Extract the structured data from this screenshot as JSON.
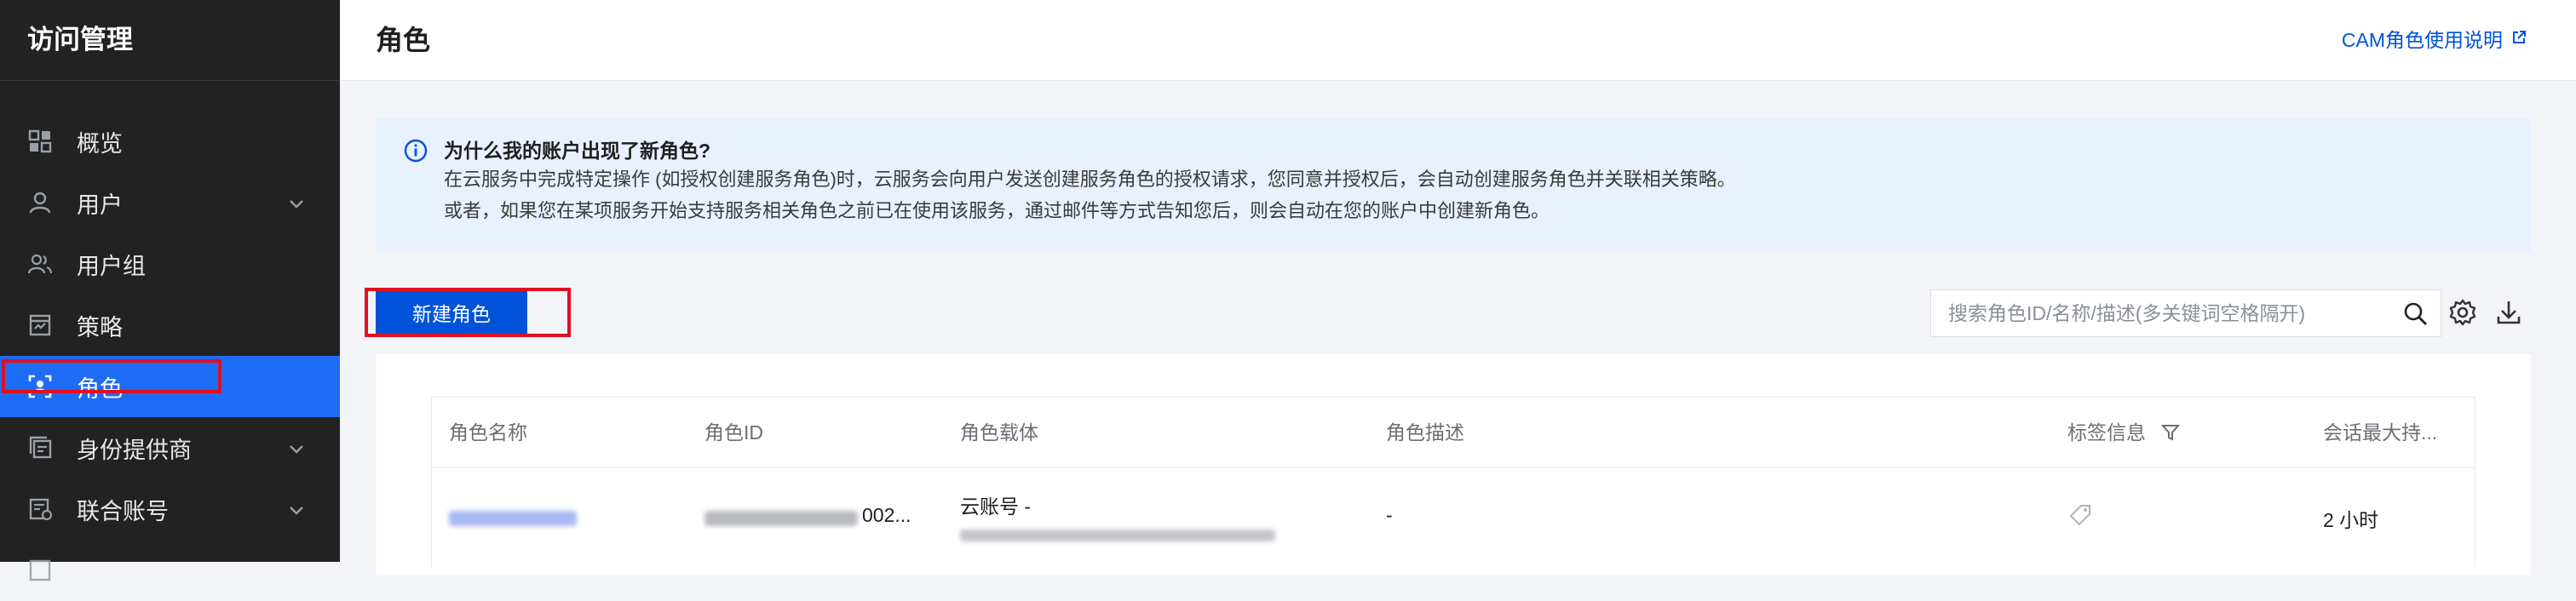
{
  "app": {
    "title": "访问管理"
  },
  "sidebar": {
    "items": [
      {
        "label": "概览",
        "icon": "dashboard-grid-icon",
        "has_chevron": false
      },
      {
        "label": "用户",
        "icon": "user-icon",
        "has_chevron": true
      },
      {
        "label": "用户组",
        "icon": "user-group-icon",
        "has_chevron": false
      },
      {
        "label": "策略",
        "icon": "policy-icon",
        "has_chevron": false
      },
      {
        "label": "角色",
        "icon": "role-icon",
        "has_chevron": false,
        "active": true
      },
      {
        "label": "身份提供商",
        "icon": "identity-provider-icon",
        "has_chevron": true
      },
      {
        "label": "联合账号",
        "icon": "federated-account-icon",
        "has_chevron": true
      }
    ]
  },
  "header": {
    "title": "角色",
    "doc_link": "CAM角色使用说明",
    "doc_link_icon": "external-link-icon"
  },
  "notice": {
    "icon": "info-icon",
    "title": "为什么我的账户出现了新角色?",
    "line1": "在云服务中完成特定操作 (如授权创建服务角色)时，云服务会向用户发送创建服务角色的授权请求，您同意并授权后，会自动创建服务角色并关联相关策略。",
    "line2": "或者，如果您在某项服务开始支持服务相关角色之前已在使用该服务，通过邮件等方式告知您后，则会自动在您的账户中创建新角色。"
  },
  "toolbar": {
    "create_label": "新建角色",
    "search_placeholder": "搜索角色ID/名称/描述(多关键词空格隔开)",
    "search_icon": "search-icon",
    "settings_icon": "gear-icon",
    "download_icon": "download-icon"
  },
  "table": {
    "columns": [
      "角色名称",
      "角色ID",
      "角色载体",
      "角色描述",
      "标签信息",
      "会话最大持..."
    ],
    "filter_icon": "filter-icon",
    "rows": [
      {
        "id_suffix": "002...",
        "carrier_line1": "云账号 -",
        "description": "-",
        "tag_icon": "tag-icon",
        "max_session": "2 小时"
      }
    ]
  },
  "colors": {
    "sidebar_bg": "#222223",
    "active_bg": "#1f6cf4",
    "primary": "#0052d9",
    "highlight_border": "#e0101f",
    "notice_bg": "#e9f0ff"
  }
}
